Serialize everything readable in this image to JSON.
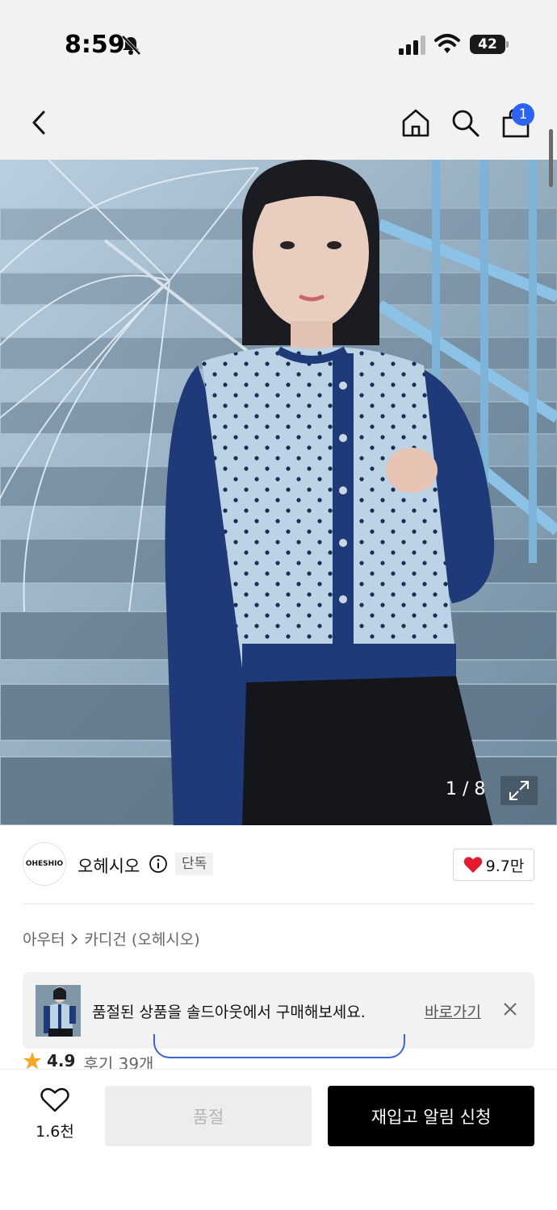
{
  "status_bar": {
    "time": "8:59",
    "battery": "42",
    "icons": [
      "bell-off-icon",
      "cellular-signal-icon",
      "wifi-icon",
      "battery-icon"
    ]
  },
  "nav": {
    "icons": [
      "back-chevron-icon",
      "home-icon",
      "search-icon",
      "shopping-bag-icon"
    ],
    "cart_count": "1"
  },
  "hero": {
    "image_description_icon": "product-photo",
    "counter": "1 / 8"
  },
  "brand": {
    "logo_text": "OHESHIO",
    "name": "오헤시오",
    "badge": "단독",
    "likes": "9.7만"
  },
  "breadcrumb": {
    "category": "아우터",
    "subcategory": "카디건 (오헤시오)"
  },
  "toast": {
    "message": "품절된 상품을 솔드아웃에서 구매해보세요.",
    "link": "바로가기"
  },
  "rating": {
    "value": "4.9",
    "reviews": "후기 39개"
  },
  "bottom_bar": {
    "wishlist_count": "1.6천",
    "sold_out_label": "품절",
    "restock_label": "재입고 알림 신청"
  },
  "colors": {
    "accent_blue": "#2a63f6",
    "heart_red": "#e8192c",
    "star_orange": "#f5a623",
    "cta_black": "#000000"
  }
}
